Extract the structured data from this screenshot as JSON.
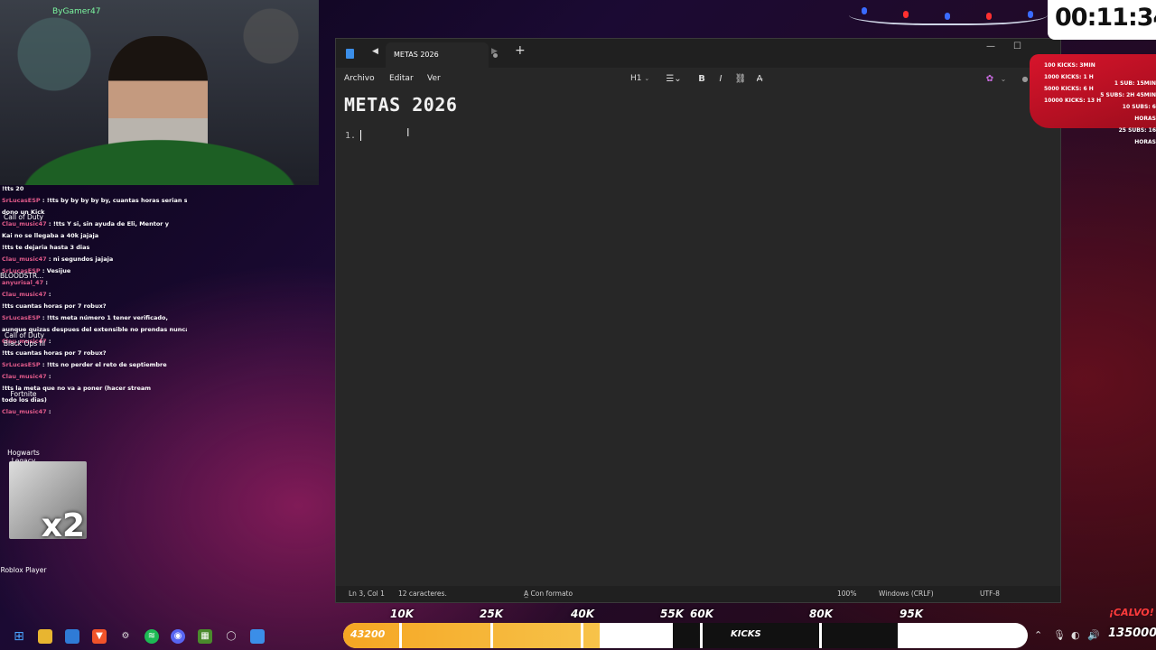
{
  "webcam": {
    "badge": "ByGamer47"
  },
  "chat": [
    {
      "user": "",
      "text": "!tts 20"
    },
    {
      "user": "SrLucasESP",
      "text": "!tts by by by by by, cuantas horas serian si"
    },
    {
      "user": "",
      "text": "dono un Kick"
    },
    {
      "user": "Clau_music47",
      "text": "!tts Y si, sin ayuda de Eli, Mentor y"
    },
    {
      "user": "",
      "text": "Kai no se llegaba a 40k jajaja"
    },
    {
      "user": "",
      "text": "!tts te dejaria hasta 3 dias"
    },
    {
      "user": "Clau_music47",
      "text": "ni segundos jajaja"
    },
    {
      "user": "SrLucasESP",
      "text": "Vesijue"
    },
    {
      "user": "anyurisal_47",
      "text": ""
    },
    {
      "user": "Clau_music47",
      "text": ""
    },
    {
      "user": "",
      "text": "!tts cuantas horas por 7 robux?"
    },
    {
      "user": "SrLucasESP",
      "text": "!tts meta número 1 tener verificado,"
    },
    {
      "user": "",
      "text": "aunque quizas despues del extensible no prendas nunca"
    },
    {
      "user": "Clau_music47",
      "text": ""
    },
    {
      "user": "",
      "text": "!tts cuantas horas por 7 robux?"
    },
    {
      "user": "SrLucasESP",
      "text": "!tts no perder el reto de septiembre"
    },
    {
      "user": "Clau_music47",
      "text": ""
    },
    {
      "user": "",
      "text": "!tts la meta que no va a poner (hacer stream"
    },
    {
      "user": "",
      "text": "todo los dias)"
    },
    {
      "user": "Clau_music47",
      "text": ""
    }
  ],
  "desktop": {
    "icons": [
      "Call of Duty",
      "BLOODSTR...",
      "Call of Duty Black Ops III",
      "Fortnite",
      "Hogwarts Legacy",
      "Roblox Player"
    ],
    "camera_overlay": "x2"
  },
  "notepad": {
    "tab_title": "METAS 2026",
    "menu": [
      "Archivo",
      "Editar",
      "Ver"
    ],
    "heading_format": "H1",
    "content_heading": "METAS 2026",
    "list_marker": "1.",
    "status": {
      "position": "Ln 3, Col 1",
      "chars": "12 caracteres.",
      "format": "Con formato",
      "zoom": "100%",
      "line_ending": "Windows (CRLF)",
      "encoding": "UTF-8"
    }
  },
  "timer": {
    "value": "00:11:34"
  },
  "goals": {
    "kicks": [
      "100 KICKS: 3MIN",
      "1000 KICKS: 1 H",
      "5000 KICKS: 6 H",
      "10000 KICKS: 13 H"
    ],
    "subs": [
      "1 SUB: 15MIN",
      "5 SUBS: 2H 45MIN",
      "10 SUBS: 6 HORAS",
      "25 SUBS: 16 HORAS"
    ]
  },
  "kicks_bar": {
    "current": "43200",
    "current_value": 43200,
    "label": "KICKS",
    "milestones": [
      "10K",
      "25K",
      "40K",
      "55K",
      "60K",
      "80K",
      "95K"
    ],
    "tag": "¡CALVO!",
    "count": "135000"
  },
  "colors": {
    "accent": "#f5a623",
    "goal_red": "#d7142b",
    "notepad_bg": "#272727"
  }
}
